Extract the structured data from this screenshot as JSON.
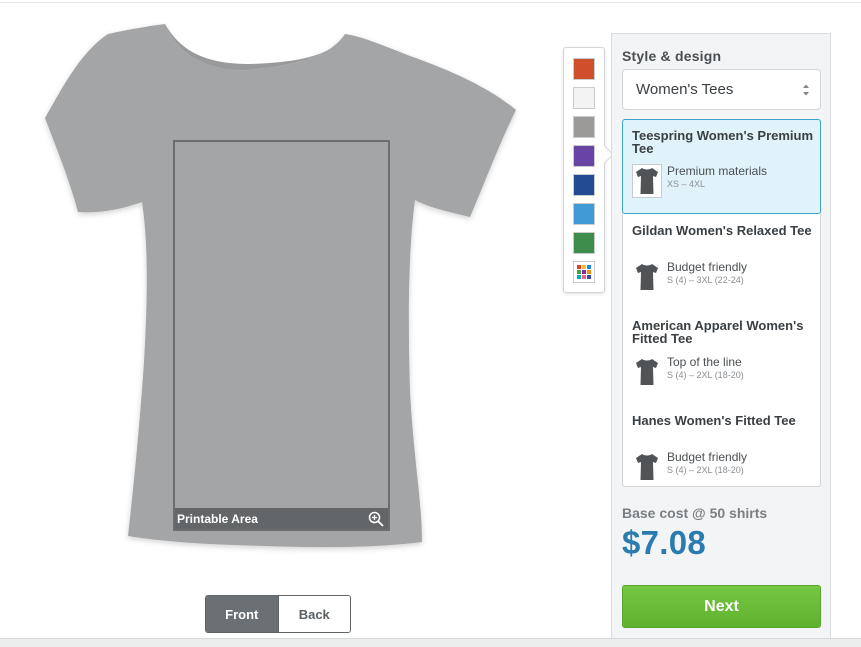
{
  "canvas": {
    "print_area_label": "Printable Area",
    "shirt_color": "#a3a5a6"
  },
  "view_toggle": {
    "front_label": "Front",
    "back_label": "Back",
    "active": "Front"
  },
  "colors": {
    "swatches": [
      {
        "name": "orange",
        "hex": "#cf4e2b"
      },
      {
        "name": "white",
        "hex": "#f3f3f3"
      },
      {
        "name": "heather-grey",
        "hex": "#9c9a98"
      },
      {
        "name": "purple",
        "hex": "#6a44a5"
      },
      {
        "name": "royal-blue",
        "hex": "#234b92"
      },
      {
        "name": "sky-blue",
        "hex": "#4199d6"
      },
      {
        "name": "green",
        "hex": "#3e8d4c"
      }
    ],
    "more_colors_icon": "color-grid-icon"
  },
  "side_panel": {
    "title": "Style & design",
    "select_value": "Women's Tees",
    "products": [
      {
        "name": "Teespring Women's Premium Tee",
        "desc": "Premium materials",
        "sizes": "XS – 4XL",
        "selected": true
      },
      {
        "name": "Gildan Women's Relaxed Tee",
        "desc": "Budget friendly",
        "sizes": "S (4) – 3XL (22-24)",
        "selected": false
      },
      {
        "name": "American Apparel Women's Fitted Tee",
        "desc": "Top of the line",
        "sizes": "S (4) – 2XL (18-20)",
        "selected": false
      },
      {
        "name": "Hanes Women's Fitted Tee",
        "desc": "Budget friendly",
        "sizes": "S (4) – 2XL (18-20)",
        "selected": false
      }
    ],
    "cost_label": "Base cost @ 50 shirts",
    "cost_value": "$7.08",
    "next_label": "Next"
  }
}
